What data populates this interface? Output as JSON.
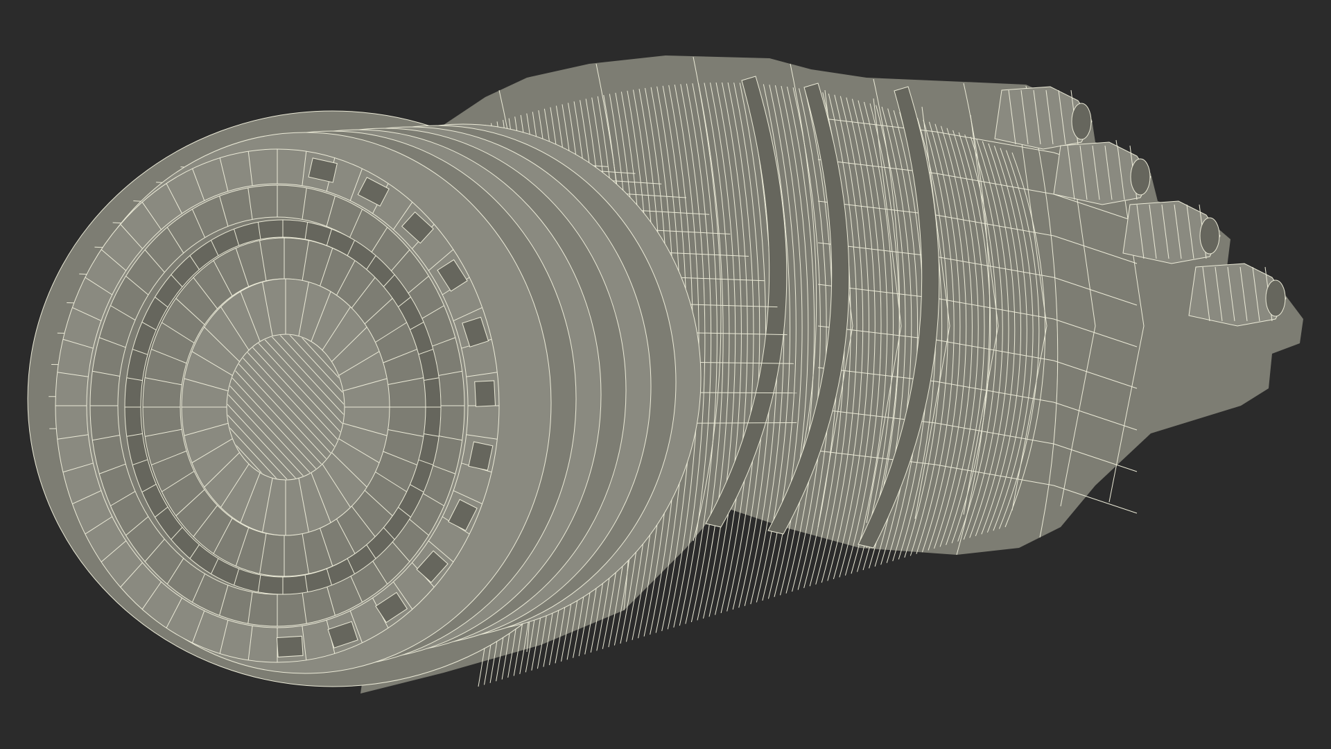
{
  "scene": {
    "subject_icon": "wireframe-3d-model-icon",
    "colors": {
      "background": "#2b2b2b",
      "surface": "#7d7d73",
      "surface_light": "#8a8a80",
      "surface_dark": "#66665d",
      "wire": "#ecebd8"
    }
  }
}
